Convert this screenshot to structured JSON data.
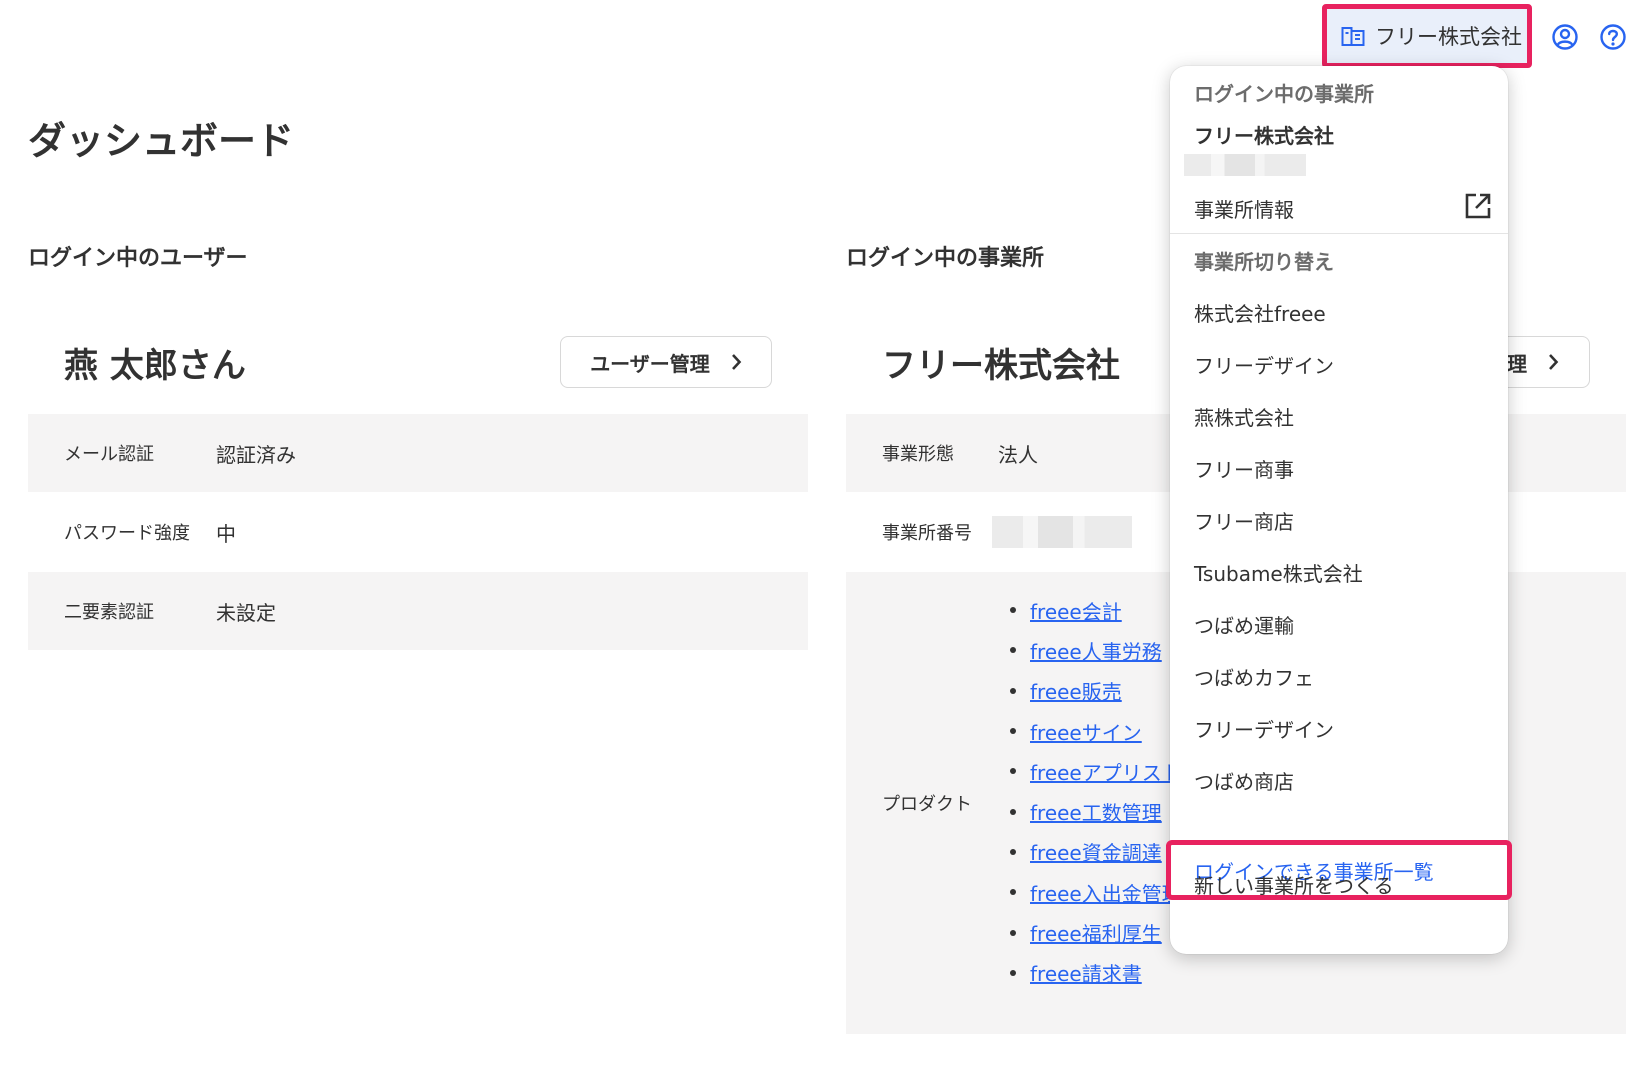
{
  "header": {
    "company_switcher_label": "フリー株式会社",
    "user_icon": "user-circle-icon",
    "help_icon": "help-circle-icon"
  },
  "page": {
    "title": "ダッシュボード"
  },
  "user_section": {
    "heading": "ログイン中のユーザー",
    "name": "燕 太郎さん",
    "manage_button_label": "ユーザー管理",
    "rows": [
      {
        "key": "メール認証",
        "value": "認証済み"
      },
      {
        "key": "パスワード強度",
        "value": "中"
      },
      {
        "key": "二要素認証",
        "value": "未設定"
      }
    ]
  },
  "company_section": {
    "heading": "ログイン中の事業所",
    "name": "フリー株式会社",
    "manage_button_label": "理",
    "type_key": "事業形態",
    "type_value": "法人",
    "number_key": "事業所番号",
    "products_key": "プロダクト",
    "products": [
      "freee会計",
      "freee人事労務",
      "freee販売",
      "freeeサイン",
      "freeeアプリスト",
      "freee工数管理",
      "freee資金調達",
      "freee入出金管理",
      "freee福利厚生",
      "freee請求書"
    ]
  },
  "dropdown": {
    "current_label": "ログイン中の事業所",
    "current_company": "フリー株式会社",
    "company_info_label": "事業所情報",
    "switch_label": "事業所切り替え",
    "companies": [
      "株式会社freee",
      "フリーデザイン",
      "燕株式会社",
      "フリー商事",
      "フリー商店",
      "Tsubame株式会社",
      "つばめ運輸",
      "つばめカフェ",
      "フリーデザイン",
      "つばめ商店"
    ],
    "login_list_label": "ログインできる事業所一覧",
    "new_company_label": "新しい事業所をつくる"
  },
  "colors": {
    "accent": "#2864f0",
    "highlight_border": "#e8225f",
    "row_background": "#f5f4f4",
    "text": "#323232"
  }
}
